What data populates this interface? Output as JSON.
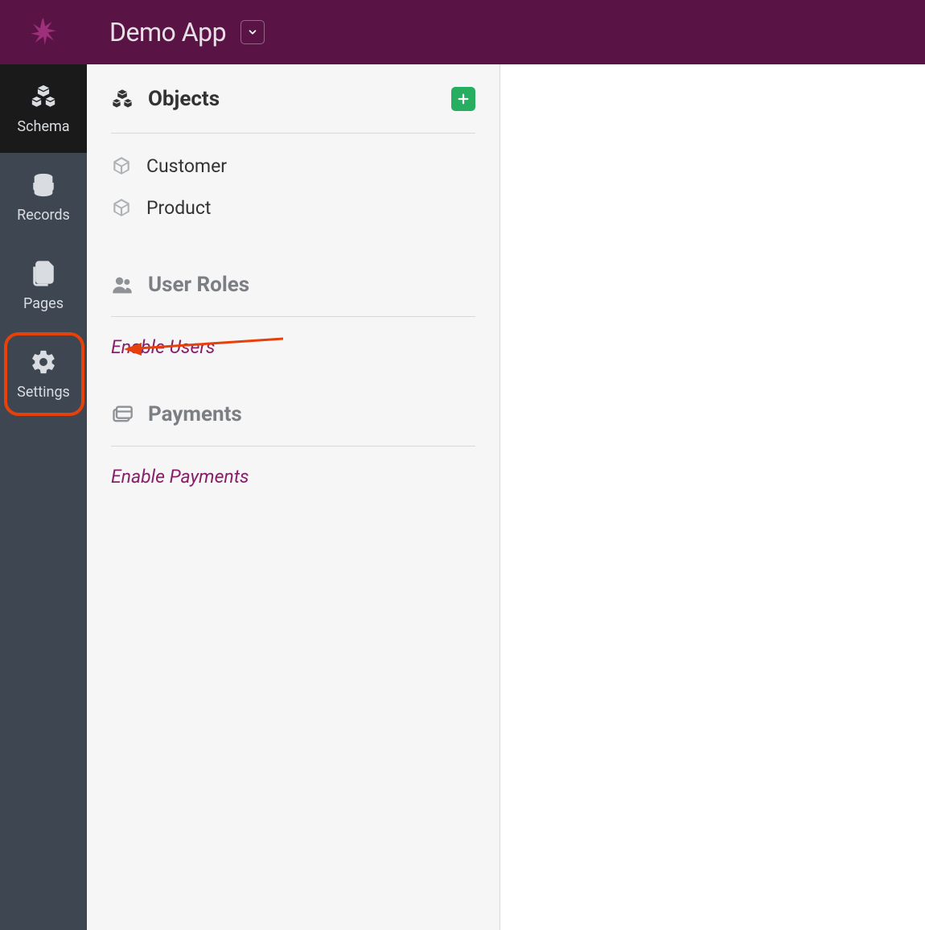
{
  "header": {
    "app_title": "Demo App"
  },
  "rail": {
    "items": [
      {
        "id": "schema",
        "label": "Schema"
      },
      {
        "id": "records",
        "label": "Records"
      },
      {
        "id": "pages",
        "label": "Pages"
      },
      {
        "id": "settings",
        "label": "Settings"
      }
    ],
    "active_id": "schema",
    "highlighted_id": "settings"
  },
  "panel": {
    "objects": {
      "title": "Objects",
      "items": [
        {
          "label": "Customer"
        },
        {
          "label": "Product"
        }
      ]
    },
    "user_roles": {
      "title": "User Roles",
      "enable_link": "Enable Users"
    },
    "payments": {
      "title": "Payments",
      "enable_link": "Enable Payments"
    }
  },
  "colors": {
    "brand_bg": "#591445",
    "brand_logo": "#9e2f7a",
    "rail_bg": "#3e4651",
    "rail_active_bg": "#1a1a1a",
    "panel_bg": "#f6f6f6",
    "add_btn": "#27ae60",
    "link": "#8a1e6b",
    "annotation": "#e6400b"
  }
}
